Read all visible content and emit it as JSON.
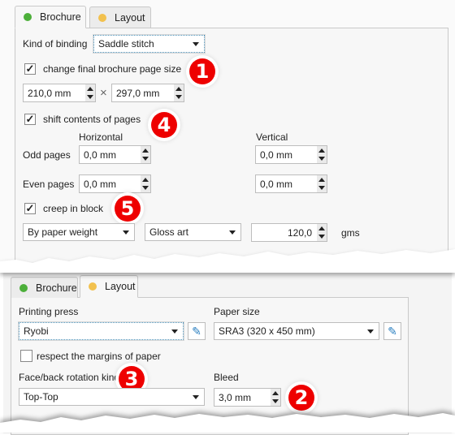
{
  "colors": {
    "brochure_dot": "#4caf3a",
    "layout_dot": "#f2c14e",
    "badge": "#e00000",
    "pencil": "#2a7fc0"
  },
  "top": {
    "tabs": [
      {
        "label": "Brochure",
        "active": true
      },
      {
        "label": "Layout",
        "active": false
      }
    ],
    "binding_label": "Kind of binding",
    "binding_value": "Saddle stitch",
    "change_size_label": "change final brochure page size",
    "change_size_checked": true,
    "width": "210,0 mm",
    "times": "×",
    "height": "297,0 mm",
    "shift_label": "shift contents of pages",
    "shift_checked": true,
    "horizontal": "Horizontal",
    "vertical": "Vertical",
    "odd_label": "Odd pages",
    "odd_h": "0,0 mm",
    "odd_v": "0,0 mm",
    "even_label": "Even pages",
    "even_h": "0,0 mm",
    "even_v": "0,0 mm",
    "creep_label": "creep in block",
    "creep_checked": true,
    "creep_method": "By paper weight",
    "paper_type": "Gloss art",
    "weight": "120,0",
    "weight_unit": "gms",
    "badges": [
      "1",
      "4",
      "5"
    ]
  },
  "bottom": {
    "tabs": [
      {
        "label": "Brochure",
        "active": false
      },
      {
        "label": "Layout",
        "active": true
      }
    ],
    "press_label": "Printing press",
    "press_value": "Ryobi",
    "paper_label": "Paper size",
    "paper_value": "SRA3 (320 x 450 mm)",
    "margins_label": "respect the margins of paper",
    "margins_checked": false,
    "rotation_label": "Face/back rotation kind",
    "rotation_value": "Top-Top",
    "bleed_label": "Bleed",
    "bleed_value": "3,0 mm",
    "badges": [
      "3",
      "2"
    ]
  }
}
